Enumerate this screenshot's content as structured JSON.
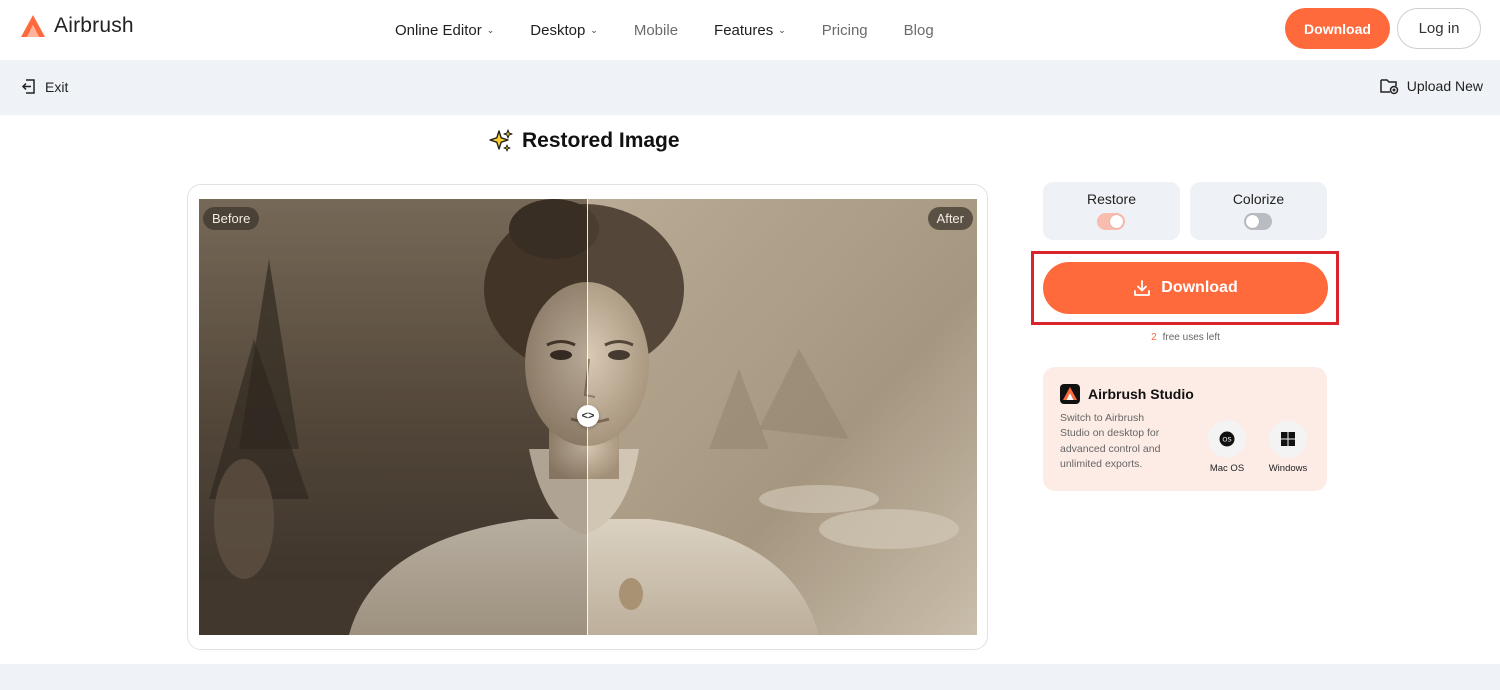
{
  "brand": {
    "name": "Airbrush",
    "accent": "#ff6a3d"
  },
  "nav": {
    "items": [
      {
        "label": "Online Editor",
        "dropdown": true,
        "muted": false
      },
      {
        "label": "Desktop",
        "dropdown": true,
        "muted": false
      },
      {
        "label": "Mobile",
        "dropdown": false,
        "muted": true
      },
      {
        "label": "Features",
        "dropdown": true,
        "muted": false
      },
      {
        "label": "Pricing",
        "dropdown": false,
        "muted": true
      },
      {
        "label": "Blog",
        "dropdown": false,
        "muted": true
      }
    ],
    "download_label": "Download",
    "login_label": "Log in"
  },
  "subbar": {
    "exit_label": "Exit",
    "upload_label": "Upload New"
  },
  "page_title": "Restored Image",
  "compare": {
    "before_label": "Before",
    "after_label": "After",
    "handle_glyph": "<>"
  },
  "options": {
    "restore": {
      "label": "Restore",
      "enabled": true
    },
    "colorize": {
      "label": "Colorize",
      "enabled": false
    }
  },
  "download": {
    "label": "Download",
    "free_uses_count": "2",
    "free_uses_text": "free uses left"
  },
  "studio": {
    "title": "Airbrush Studio",
    "description": "Switch to Airbrush Studio on desktop for advanced control and unlimited exports.",
    "platforms": [
      {
        "label": "Mac OS",
        "icon": "apple-icon"
      },
      {
        "label": "Windows",
        "icon": "windows-icon"
      }
    ]
  }
}
